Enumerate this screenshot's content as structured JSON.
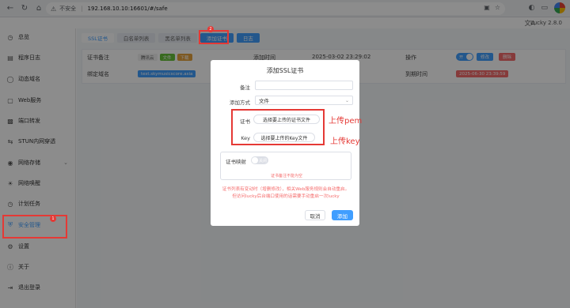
{
  "browser": {
    "security": "不安全",
    "url": "192.168.10.10:16601/#/safe"
  },
  "app": {
    "title": "Lucky 2.8.0"
  },
  "sidebar": {
    "items": [
      {
        "label": "总览",
        "icon": "dashboard-icon"
      },
      {
        "label": "程序日志",
        "icon": "log-icon"
      },
      {
        "label": "动态域名",
        "icon": "ddns-icon"
      },
      {
        "label": "Web服务",
        "icon": "web-icon"
      },
      {
        "label": "端口转发",
        "icon": "forward-icon"
      },
      {
        "label": "STUN内网穿透",
        "icon": "stun-icon"
      },
      {
        "label": "网络存储",
        "icon": "storage-icon"
      },
      {
        "label": "网络唤醒",
        "icon": "wol-icon"
      },
      {
        "label": "计划任务",
        "icon": "clock-icon"
      },
      {
        "label": "安全管理",
        "icon": "shield-icon"
      },
      {
        "label": "设置",
        "icon": "gear-icon"
      },
      {
        "label": "关于",
        "icon": "info-icon"
      },
      {
        "label": "退出登录",
        "icon": "logout-icon"
      }
    ]
  },
  "tabs": [
    {
      "label": "SSL证书"
    },
    {
      "label": "白名单列表"
    },
    {
      "label": "黑名单列表"
    },
    {
      "label": "添加证书"
    },
    {
      "label": "日志"
    }
  ],
  "card": {
    "remark_label": "证书备注",
    "remark_tags": [
      "腾讯云",
      "文件",
      "下载"
    ],
    "domain_label": "绑定域名",
    "domain_tag": "test.skymusicscore.asia",
    "created_label": "添加时间",
    "created_value": "2025-03-02 23:29:02",
    "op_label": "操作",
    "switch_text": "开",
    "edit_label": "修改",
    "delete_label": "删除",
    "expire_label": "到期时间",
    "expire_value": "2025-06-30 23:39:59"
  },
  "dialog": {
    "title": "添加SSL证书",
    "remark_label": "备注",
    "remark_value": "",
    "mode_label": "添加方式",
    "mode_value": "文件",
    "cert_label": "证书",
    "cert_button": "选择要上传的证书文件",
    "key_label": "Key",
    "key_button": "选择要上传的Key文件",
    "map_label": "证书映射",
    "map_switch": "关闭",
    "map_error": "证书备注不能为空",
    "note": "证书列表有变动时（增删修改），相关Web服务规则会自动重启。但访问lucky后台端口使用的话需要手动重启一次lucky",
    "cancel_label": "取消",
    "confirm_label": "添加"
  },
  "annotations": {
    "badge1": "1",
    "badge2": "2",
    "upload_pem": "上传pem",
    "upload_key": "上传key"
  }
}
